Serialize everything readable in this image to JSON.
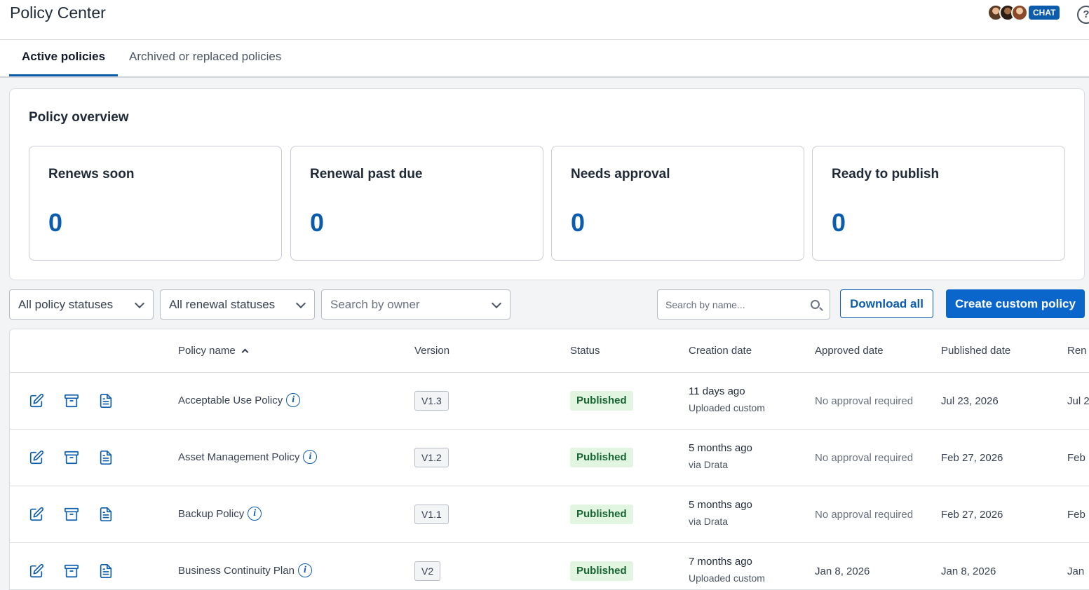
{
  "header": {
    "title": "Policy Center",
    "chat_label": "CHAT",
    "help_glyph": "?"
  },
  "tabs": [
    {
      "label": "Active policies",
      "active": true
    },
    {
      "label": "Archived or replaced policies",
      "active": false
    }
  ],
  "overview": {
    "title": "Policy overview",
    "cards": [
      {
        "label": "Renews soon",
        "value": "0"
      },
      {
        "label": "Renewal past due",
        "value": "0"
      },
      {
        "label": "Needs approval",
        "value": "0"
      },
      {
        "label": "Ready to publish",
        "value": "0"
      }
    ]
  },
  "filters": {
    "policy_status": "All policy statuses",
    "renewal_status": "All renewal statuses",
    "owner_placeholder": "Search by owner",
    "search_placeholder": "Search by name..."
  },
  "actions": {
    "download_all": "Download all",
    "create_custom": "Create custom policy"
  },
  "table": {
    "columns": {
      "policy_name": "Policy name",
      "version": "Version",
      "status": "Status",
      "creation_date": "Creation date",
      "approved_date": "Approved date",
      "published_date": "Published date",
      "renewal": "Ren"
    },
    "rows": [
      {
        "name": "Acceptable Use Policy",
        "version": "V1.3",
        "status": "Published",
        "created": "11 days ago",
        "created_via": "Uploaded custom",
        "approved": "No approval required",
        "published": "Jul 23, 2026",
        "renewal": "Jul 2"
      },
      {
        "name": "Asset Management Policy",
        "version": "V1.2",
        "status": "Published",
        "created": "5 months ago",
        "created_via": "via Drata",
        "approved": "No approval required",
        "published": "Feb 27, 2026",
        "renewal": "Feb"
      },
      {
        "name": "Backup Policy",
        "version": "V1.1",
        "status": "Published",
        "created": "5 months ago",
        "created_via": "via Drata",
        "approved": "No approval required",
        "published": "Feb 27, 2026",
        "renewal": "Feb"
      },
      {
        "name": "Business Continuity Plan",
        "version": "V2",
        "status": "Published",
        "created": "7 months ago",
        "created_via": "Uploaded custom",
        "approved": "Jan 8, 2026",
        "published": "Jan 8, 2026",
        "renewal": "Jan"
      }
    ]
  },
  "colors": {
    "accent": "#0b5cad",
    "primary_button": "#0b66cc",
    "published_bg": "#e2f5e0",
    "published_text": "#166534"
  }
}
